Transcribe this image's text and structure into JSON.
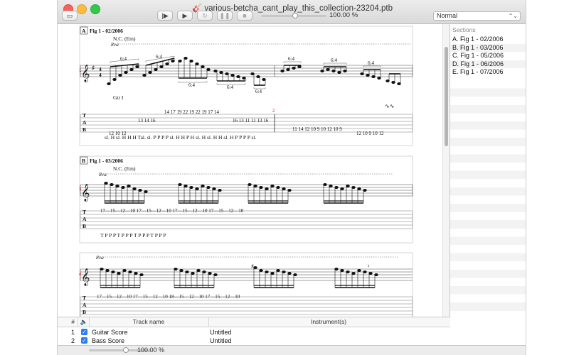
{
  "window": {
    "title": "various-betcha_cant_play_this_collection-23204.ptb",
    "file_icon": "guitar-document-icon"
  },
  "toolbar": {
    "print_icon": "printer-icon",
    "play_from_start_icon": "play-from-start-icon",
    "play_icon": "play-icon",
    "loop_icon": "loop-icon",
    "pause_icon": "pause-icon",
    "stop_icon": "stop-icon",
    "speed_label": "100.00 %",
    "view_select": "Normal"
  },
  "score": {
    "systems": [
      {
        "box_label": "A",
        "section_title": "Fig 1 - 02/2006",
        "chord": "N.C. (Em)",
        "octave": "8va",
        "guitar_label": "Gtr I",
        "tab_numbers": "14 17 19 22 19 22 19 17 14",
        "tab_numbers_2": "13 14 16",
        "tab_numbers_3": "16 13 11 11 13 16",
        "tab_numbers_4": "11 14 12 10 9 10 12 10 9",
        "tab_numbers_5": "12 10 12",
        "tab_numbers_6": "12 10 9 10 12",
        "tuplets": [
          "6:4",
          "6:4",
          "6:4",
          "6:4",
          "6:4",
          "6:4",
          "6:4",
          "6:4"
        ],
        "articulations": "sl. H    sl. H    H H  Tal.  sl. P P P   P  sl. H H P H  sl.  H   sl.  H  H  sl. H P P   P P  sl.",
        "measure_number": "2"
      },
      {
        "box_label": "B",
        "section_title": "Fig 1 - 03/2006",
        "chord": "N.C. (Em)",
        "octave": "8va",
        "tab_numbers": "17—15—12—10    17—15—12—10    17—15—12—10    17—15—12—10",
        "articulations": "T P  P   P   T P  P   P   T P  P   P   T P  P   P",
        "measure_number": "3"
      },
      {
        "octave": "8va",
        "tab_numbers": "17—15—12—10    17—15—12—10    18—15—12—10    17—15—12—10",
        "measure_number": "4"
      }
    ],
    "tab_letters": [
      "T",
      "A",
      "B"
    ],
    "time_signature_top": "4",
    "time_signature_bottom": "4"
  },
  "sections_panel": {
    "header": "Sections",
    "items": [
      "A. Fig 1 - 02/2006",
      "B. Fig 1 - 03/2006",
      "C. Fig 1 - 05/2006",
      "D. Fig 1 - 06/2006",
      "E. Fig 1 - 07/2006"
    ]
  },
  "tracks": {
    "headers": {
      "num": "#",
      "mix_icon": "speaker-icon",
      "name": "Track name",
      "instrument": "Instrument(s)"
    },
    "rows": [
      {
        "num": "1",
        "name": "Guitar Score",
        "instrument": "Untitled"
      },
      {
        "num": "2",
        "name": "Bass Score",
        "instrument": "Untitled"
      }
    ]
  },
  "statusbar": {
    "zoom_label": "100.00 %"
  }
}
